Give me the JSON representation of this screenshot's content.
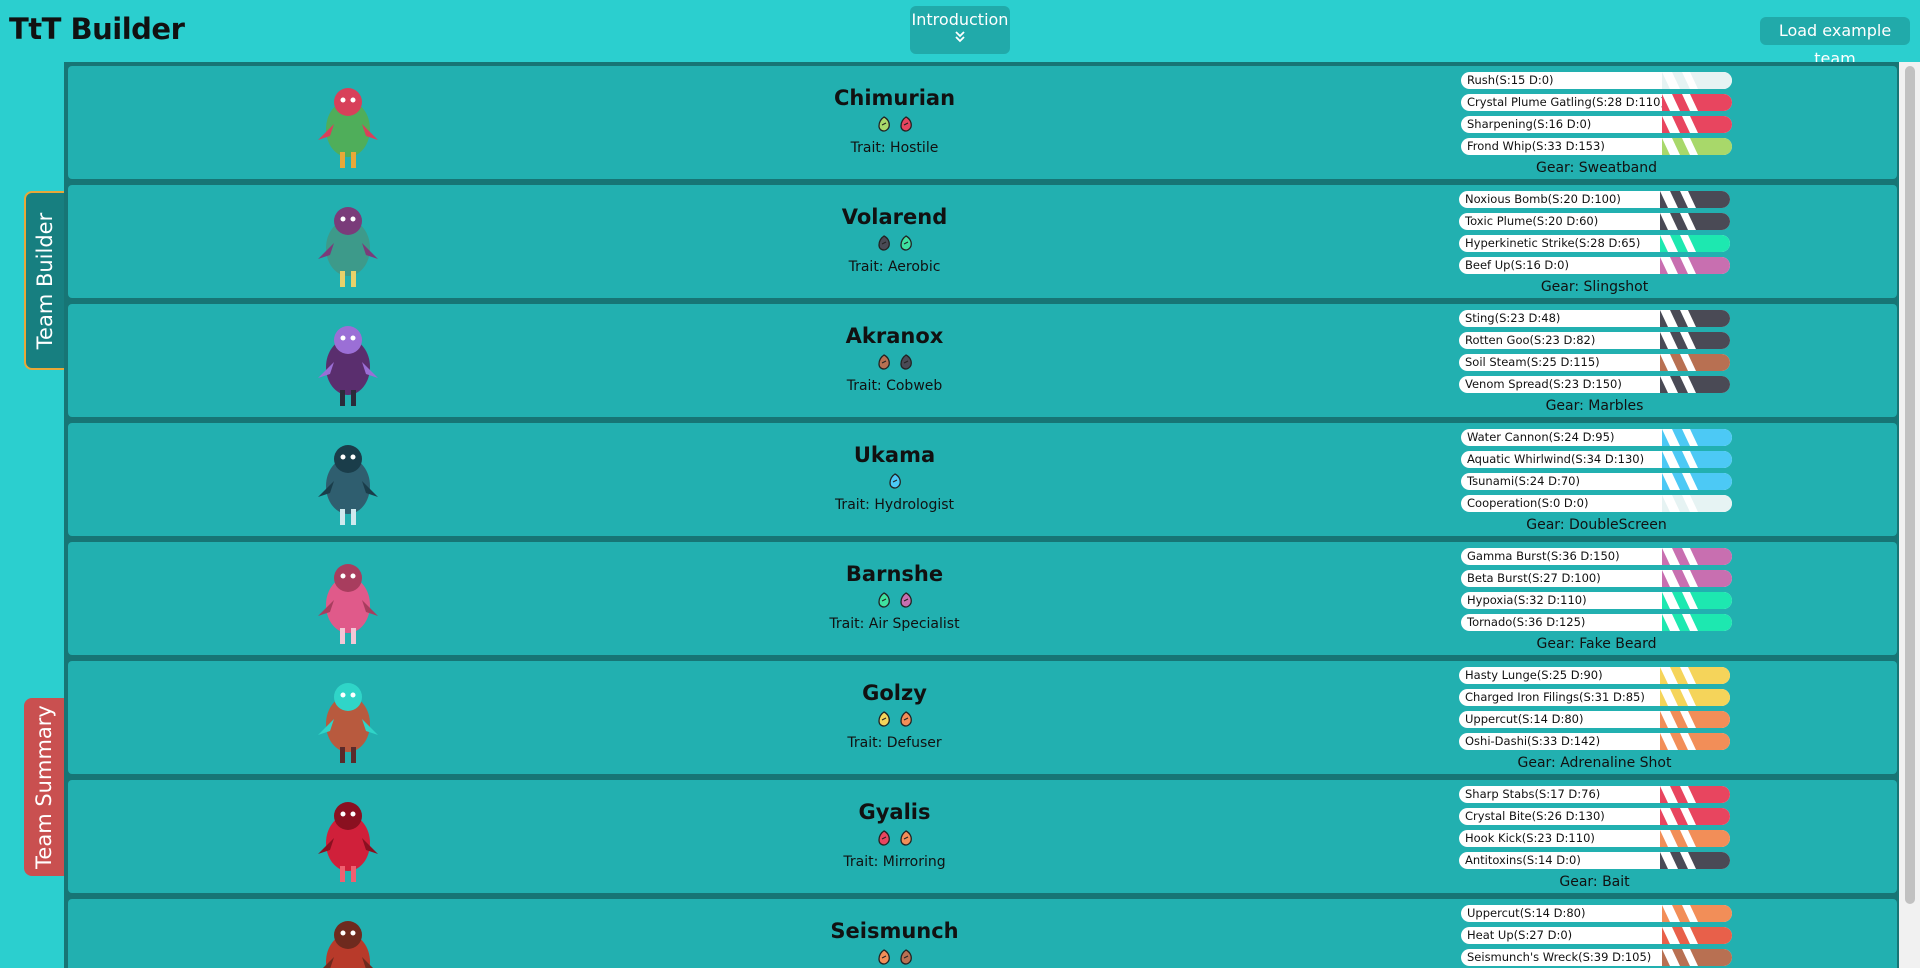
{
  "app": {
    "title": "TtT Builder"
  },
  "header": {
    "intro_label": "Introduction",
    "load_label": "Load example team"
  },
  "side_tabs": {
    "builder": "Team Builder",
    "summary": "Team Summary"
  },
  "team": [
    {
      "name": "Chimurian",
      "trait": "Trait: Hostile",
      "gear": "Gear: Sweatband",
      "types": [
        {
          "icon": "nature-type-icon",
          "color": "#a8d86a"
        },
        {
          "icon": "crystal-type-icon",
          "color": "#e8455f"
        }
      ],
      "moves": [
        {
          "label": "Rush(S:15 D:0)",
          "color": "#e6f3f3"
        },
        {
          "label": "Crystal Plume Gatling(S:28 D:110)",
          "color": "#e8455f"
        },
        {
          "label": "Sharpening(S:16 D:0)",
          "color": "#e8455f"
        },
        {
          "label": "Frond Whip(S:33 D:153)",
          "color": "#a8d86a"
        }
      ]
    },
    {
      "name": "Volarend",
      "trait": "Trait: Aerobic",
      "gear": "Gear: Slingshot",
      "types": [
        {
          "icon": "toxic-type-icon",
          "color": "#4a4a55"
        },
        {
          "icon": "air-type-icon",
          "color": "#3fe2a0"
        }
      ],
      "moves": [
        {
          "label": "Noxious Bomb(S:20 D:100)",
          "color": "#4a4a55"
        },
        {
          "label": "Toxic Plume(S:20 D:60)",
          "color": "#4a4a55"
        },
        {
          "label": "Hyperkinetic Strike(S:28 D:65)",
          "color": "#1de8b0"
        },
        {
          "label": "Beef Up(S:16 D:0)",
          "color": "#c86fb0"
        }
      ]
    },
    {
      "name": "Akranox",
      "trait": "Trait: Cobweb",
      "gear": "Gear: Marbles",
      "types": [
        {
          "icon": "earth-type-icon",
          "color": "#b87052"
        },
        {
          "icon": "toxic-type-icon",
          "color": "#4a4a55"
        }
      ],
      "moves": [
        {
          "label": "Sting(S:23 D:48)",
          "color": "#4a4a55"
        },
        {
          "label": "Rotten Goo(S:23 D:82)",
          "color": "#4a4a55"
        },
        {
          "label": "Soil Steam(S:25 D:115)",
          "color": "#b87052"
        },
        {
          "label": "Venom Spread(S:23 D:150)",
          "color": "#4a4a55"
        }
      ]
    },
    {
      "name": "Ukama",
      "trait": "Trait: Hydrologist",
      "gear": "Gear: DoubleScreen",
      "types": [
        {
          "icon": "water-type-icon",
          "color": "#4cc9f5"
        }
      ],
      "moves": [
        {
          "label": "Water Cannon(S:24 D:95)",
          "color": "#4cc9f5"
        },
        {
          "label": "Aquatic Whirlwind(S:34 D:130)",
          "color": "#4cc9f5"
        },
        {
          "label": "Tsunami(S:24 D:70)",
          "color": "#4cc9f5"
        },
        {
          "label": "Cooperation(S:0 D:0)",
          "color": "#e6f3f3"
        }
      ]
    },
    {
      "name": "Barnshe",
      "trait": "Trait: Air Specialist",
      "gear": "Gear: Fake Beard",
      "types": [
        {
          "icon": "air-type-icon",
          "color": "#3fe2a0"
        },
        {
          "icon": "mind-type-icon",
          "color": "#c86fb0"
        }
      ],
      "moves": [
        {
          "label": "Gamma Burst(S:36 D:150)",
          "color": "#c86fb0"
        },
        {
          "label": "Beta Burst(S:27 D:100)",
          "color": "#c86fb0"
        },
        {
          "label": "Hypoxia(S:32 D:110)",
          "color": "#1de8b0"
        },
        {
          "label": "Tornado(S:36 D:125)",
          "color": "#1de8b0"
        }
      ]
    },
    {
      "name": "Golzy",
      "trait": "Trait: Defuser",
      "gear": "Gear: Adrenaline Shot",
      "types": [
        {
          "icon": "electric-type-icon",
          "color": "#f5d45a"
        },
        {
          "icon": "melee-type-icon",
          "color": "#f28e58"
        }
      ],
      "moves": [
        {
          "label": "Hasty Lunge(S:25 D:90)",
          "color": "#f5d45a"
        },
        {
          "label": "Charged Iron Filings(S:31 D:85)",
          "color": "#f5d45a"
        },
        {
          "label": "Uppercut(S:14 D:80)",
          "color": "#f28e58"
        },
        {
          "label": "Oshi-Dashi(S:33 D:142)",
          "color": "#f28e58"
        }
      ]
    },
    {
      "name": "Gyalis",
      "trait": "Trait: Mirroring",
      "gear": "Gear: Bait",
      "types": [
        {
          "icon": "crystal-type-icon",
          "color": "#e8455f"
        },
        {
          "icon": "melee-type-icon",
          "color": "#f28e58"
        }
      ],
      "moves": [
        {
          "label": "Sharp Stabs(S:17 D:76)",
          "color": "#e8455f"
        },
        {
          "label": "Crystal Bite(S:26 D:130)",
          "color": "#e8455f"
        },
        {
          "label": "Hook Kick(S:23 D:110)",
          "color": "#f28e58"
        },
        {
          "label": "Antitoxins(S:14 D:0)",
          "color": "#4a4a55"
        }
      ]
    },
    {
      "name": "Seismunch",
      "trait": "",
      "gear": "",
      "types": [
        {
          "icon": "melee-type-icon",
          "color": "#f28e58"
        },
        {
          "icon": "earth-type-icon",
          "color": "#b87052"
        }
      ],
      "moves": [
        {
          "label": "Uppercut(S:14 D:80)",
          "color": "#f28e58"
        },
        {
          "label": "Heat Up(S:27 D:0)",
          "color": "#e8604a"
        },
        {
          "label": "Seismunch's Wreck(S:39 D:105)",
          "color": "#b87052"
        }
      ]
    }
  ]
}
